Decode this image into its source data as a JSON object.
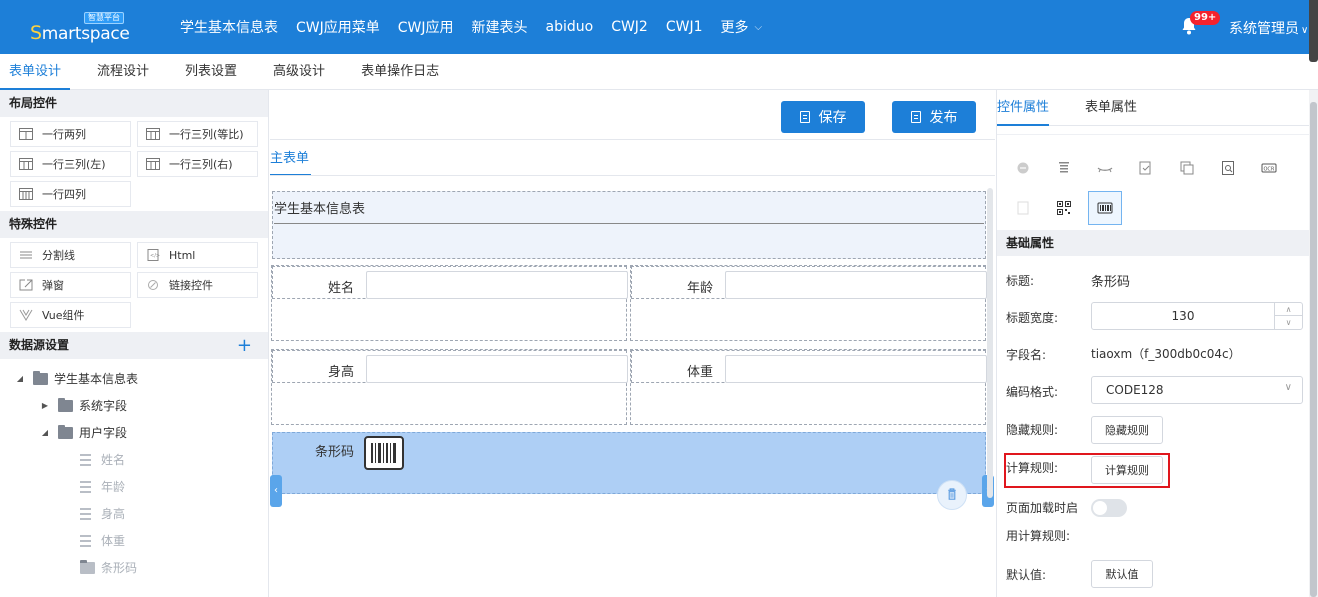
{
  "header": {
    "logo_text": "Smartspace",
    "logo_tag": "智慧平台",
    "nav": [
      "学生基本信息表",
      "CWJ应用菜单",
      "CWJ应用",
      "新建表头",
      "abiduo",
      "CWJ2",
      "CWJ1"
    ],
    "more_label": "更多",
    "notification_badge": "99+",
    "user_name": "系统管理员",
    "brand_color": "#1d7fd8"
  },
  "tabs": [
    "表单设计",
    "流程设计",
    "列表设置",
    "高级设计",
    "表单操作日志"
  ],
  "left": {
    "layout_title": "布局控件",
    "layout_widgets": [
      "一行两列",
      "一行三列(等比)",
      "一行三列(左)",
      "一行三列(右)",
      "一行四列"
    ],
    "special_title": "特殊控件",
    "special_widgets": [
      {
        "label": "分割线",
        "icon": "divider-icon"
      },
      {
        "label": "Html",
        "icon": "html-icon"
      },
      {
        "label": "弹窗",
        "icon": "popup-icon"
      },
      {
        "label": "链接控件",
        "icon": "link-icon"
      },
      {
        "label": "Vue组件",
        "icon": "vue-icon"
      }
    ],
    "datasource_title": "数据源设置",
    "tree": {
      "root": "学生基本信息表",
      "system_fields": "系统字段",
      "user_fields": "用户字段",
      "fields": [
        "姓名",
        "年龄",
        "身高",
        "体重",
        "条形码"
      ]
    }
  },
  "center": {
    "save_label": "保存",
    "publish_label": "发布",
    "form_tab": "主表单",
    "form_title": "学生基本信息表",
    "fields": {
      "name": "姓名",
      "age": "年龄",
      "height": "身高",
      "weight": "体重",
      "barcode": "条形码"
    }
  },
  "right": {
    "tab_control": "控件属性",
    "tab_form": "表单属性",
    "base_title": "基础属性",
    "labels": {
      "title": "标题:",
      "title_width": "标题宽度:",
      "field_name": "字段名:",
      "encoding": "编码格式:",
      "hide_rule": "隐藏规则:",
      "calc_rule": "计算规则:",
      "load_calc_line1": "页面加载时启",
      "load_calc_line2": "用计算规则:",
      "default_value": "默认值:"
    },
    "values": {
      "title": "条形码",
      "title_width": "130",
      "field_name": "tiaoxm（f_300db0c04c）",
      "encoding": "CODE128"
    },
    "buttons": {
      "hide_rule": "隐藏规则",
      "calc_rule": "计算规则",
      "default_value": "默认值"
    }
  }
}
